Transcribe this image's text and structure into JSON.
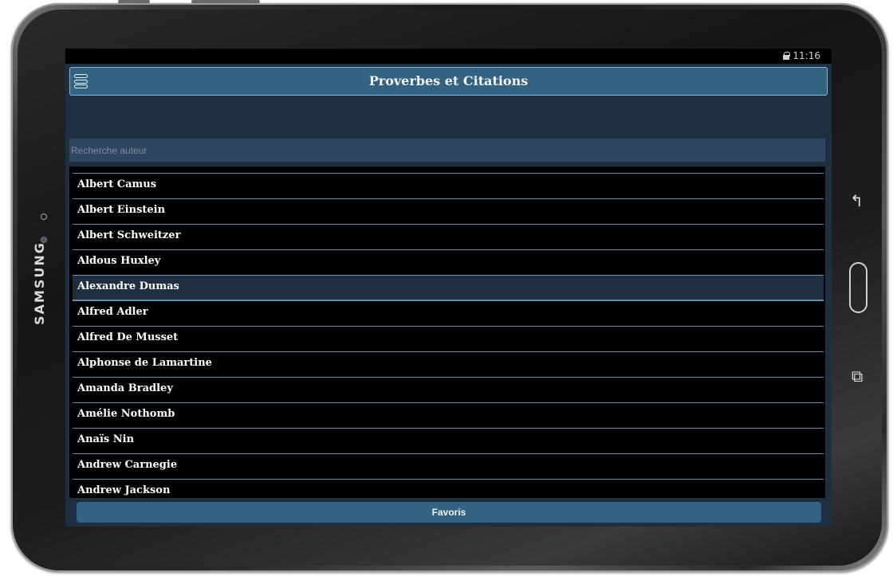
{
  "device": {
    "brand": "SAMSUNG",
    "nav": {
      "back_icon": "back-arrow-icon",
      "home_icon": "home-button-icon",
      "recent_icon": "recent-apps-icon"
    }
  },
  "status_bar": {
    "time": "11:16",
    "icon": "lock-icon"
  },
  "app_bar": {
    "title": "Proverbes et Citations",
    "menu_icon": "hamburger-menu-icon"
  },
  "search": {
    "placeholder": "Recherche auteur",
    "value": ""
  },
  "authors": [
    {
      "name": "Albert Camus",
      "selected": false
    },
    {
      "name": "Albert Einstein",
      "selected": false
    },
    {
      "name": "Albert Schweitzer",
      "selected": false
    },
    {
      "name": "Aldous Huxley",
      "selected": false
    },
    {
      "name": "Alexandre Dumas",
      "selected": true
    },
    {
      "name": "Alfred Adler",
      "selected": false
    },
    {
      "name": "Alfred De Musset",
      "selected": false
    },
    {
      "name": "Alphonse de Lamartine",
      "selected": false
    },
    {
      "name": "Amanda Bradley",
      "selected": false
    },
    {
      "name": "Amélie Nothomb",
      "selected": false
    },
    {
      "name": "Anaïs Nin",
      "selected": false
    },
    {
      "name": "Andrew Carnegie",
      "selected": false
    },
    {
      "name": "Andrew Jackson",
      "selected": false
    }
  ],
  "footer": {
    "favorites_label": "Favoris"
  },
  "colors": {
    "accent": "#336380",
    "screen_bg": "#1e2f42",
    "list_bg": "#000000",
    "divider": "#6a8eaa"
  }
}
